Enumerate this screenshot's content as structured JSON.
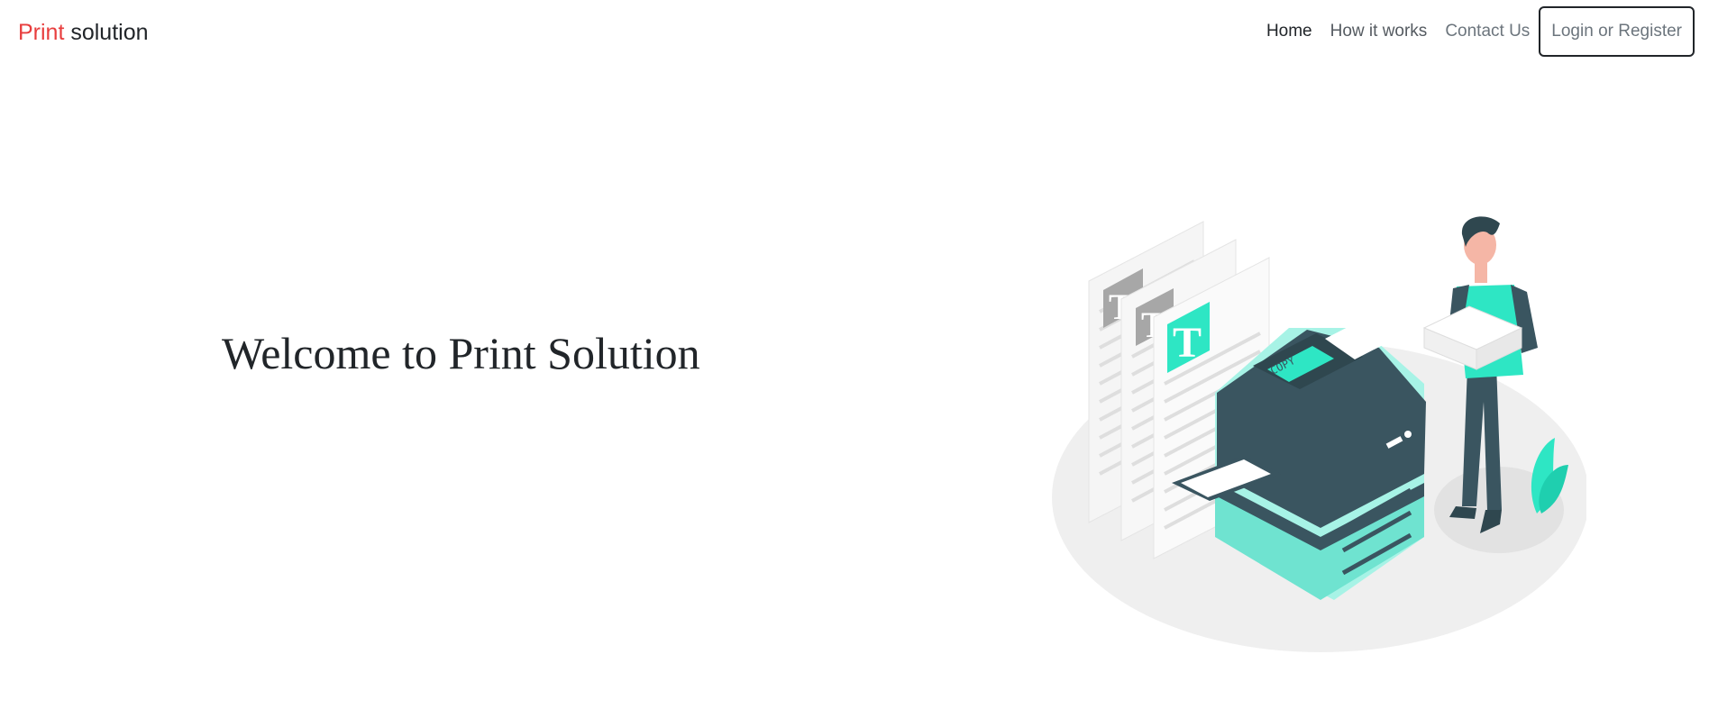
{
  "navbar": {
    "brand_first": "Print",
    "brand_second": " solution",
    "links": [
      {
        "label": "Home"
      },
      {
        "label": "How it works"
      },
      {
        "label": "Contact Us"
      }
    ],
    "login_label": "Login or Register"
  },
  "hero": {
    "title": "Welcome to Print Solution",
    "illustration": {
      "printer_screen_text": "COPY",
      "document_letter": "T"
    }
  },
  "colors": {
    "accent_red": "#e83e3e",
    "illustration_teal": "#2ee6c4",
    "printer_dark": "#3a5560"
  },
  "icons": [
    "printer-illustration"
  ]
}
